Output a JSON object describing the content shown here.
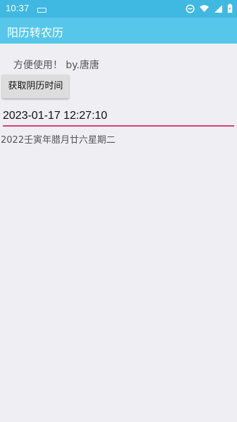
{
  "status_bar": {
    "time": "10:37",
    "colors": {
      "status_bar": "#3fb8e2"
    },
    "icons": [
      "notification-icon",
      "do-not-disturb-icon",
      "wifi-icon",
      "signal-icon",
      "battery-icon"
    ]
  },
  "app_bar": {
    "title": "阳历转农历",
    "color": "#56c7ea"
  },
  "main": {
    "author_text": "方便使用！ by.唐唐",
    "button_label": "获取阴历时间",
    "date_value": "2023-01-17 12:27:10",
    "result_text": "2022壬寅年腊月廿六星期二"
  },
  "colors": {
    "background": "#efeef3",
    "input_underline": "#d6416d",
    "button": "#dddddd"
  }
}
